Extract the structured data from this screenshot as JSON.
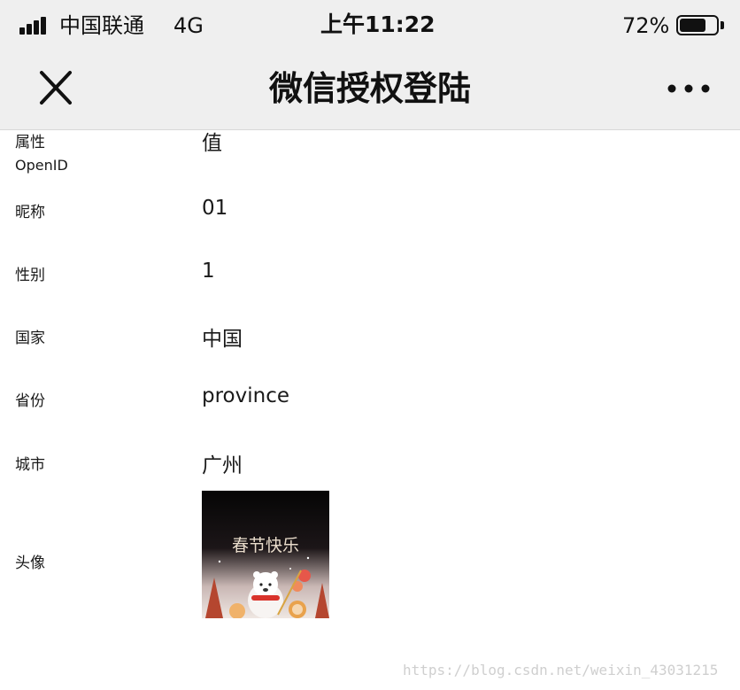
{
  "status_bar": {
    "carrier": "中国联通",
    "network": "4G",
    "time": "上午11:22",
    "battery_percent_text": "72%",
    "battery_level": 0.72
  },
  "nav": {
    "title": "微信授权登陆",
    "close_icon": "close-icon",
    "more_icon": "more-dots-icon"
  },
  "table": {
    "header_label": "属性",
    "header_value": "值",
    "openid_label": "OpenID",
    "rows": [
      {
        "label": "昵称",
        "value": "01"
      },
      {
        "label": "性别",
        "value": "1"
      },
      {
        "label": "国家",
        "value": "中国"
      },
      {
        "label": "省份",
        "value": "province"
      },
      {
        "label": "城市",
        "value": "广州"
      }
    ],
    "avatar_label": "头像",
    "avatar_text": "春节快乐"
  },
  "watermark": "https://blog.csdn.net/weixin_43031215",
  "colors": {
    "bar_background": "#efefef",
    "text": "#1a1a1a"
  }
}
